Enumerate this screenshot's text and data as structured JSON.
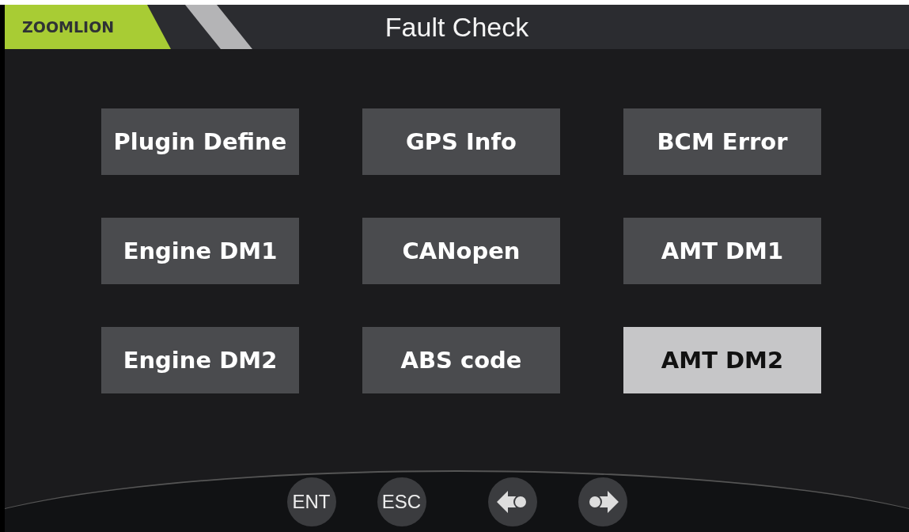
{
  "header": {
    "logo": "ZOOMLION",
    "title": "Fault Check"
  },
  "menu": [
    {
      "label": "Plugin Define",
      "selected": false
    },
    {
      "label": "GPS Info",
      "selected": false
    },
    {
      "label": "BCM Error",
      "selected": false
    },
    {
      "label": "Engine DM1",
      "selected": false
    },
    {
      "label": "CANopen",
      "selected": false
    },
    {
      "label": "AMT DM1",
      "selected": false
    },
    {
      "label": "Engine DM2",
      "selected": false
    },
    {
      "label": "ABS code",
      "selected": false
    },
    {
      "label": "AMT DM2",
      "selected": true
    }
  ],
  "footer": [
    {
      "kind": "text",
      "label": "ENT"
    },
    {
      "kind": "text",
      "label": "ESC"
    },
    {
      "kind": "prev"
    },
    {
      "kind": "next"
    }
  ]
}
